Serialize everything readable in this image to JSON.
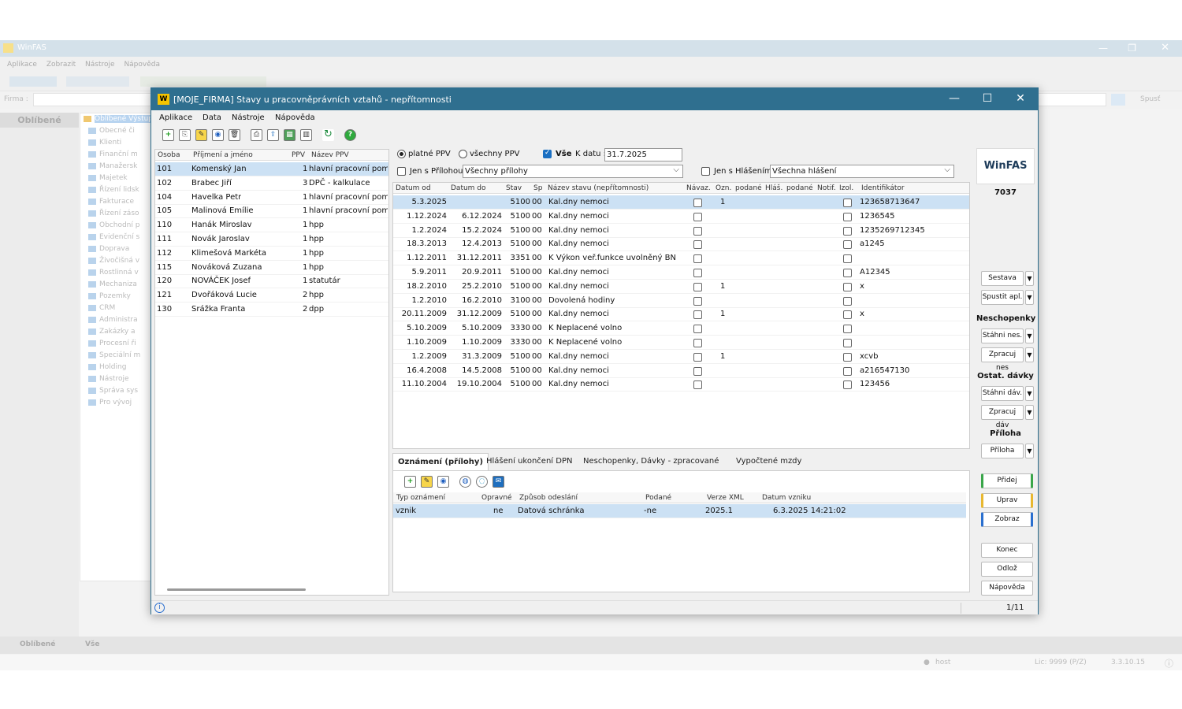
{
  "bg": {
    "title": "WinFAS",
    "menu": [
      "Aplikace",
      "Zobrazit",
      "Nástroje",
      "Nápověda"
    ],
    "firma_label": "Firma :",
    "spust": "Spusť",
    "left_header": "Oblíbené",
    "tree_selected": "Oblíbené Výstupy",
    "tree_items": [
      "Obecné či",
      "Klienti",
      "Finanční m",
      "Manažersk",
      "Majetek",
      "Řízení lidsk",
      "Fakturace",
      "Řízení záso",
      "Obchodní p",
      "Evidenční s",
      "Doprava",
      "Živočišná v",
      "Rostlinná v",
      "Mechaniza",
      "Pozemky",
      "CRM",
      "Administra",
      "Zakázky a",
      "Procesní ři",
      "Speciální m",
      "Holding",
      "Nástroje",
      "Správa sys",
      "Pro vývoj"
    ],
    "bottom_tabs": [
      "Oblíbené",
      "Vše"
    ],
    "status_user": "host",
    "status_lic": "Lic: 9999 (P/Z)",
    "status_ver": "3.3.10.15"
  },
  "win": {
    "title": "[MOJE_FIRMA] Stavy u pracovněprávních vztahů - nepřítomnosti",
    "menu": [
      "Aplikace",
      "Data",
      "Nástroje",
      "Nápověda"
    ],
    "left_grid": {
      "headers": [
        "Osoba",
        "Příjmení a jméno",
        "PPV",
        "Název PPV"
      ],
      "rows": [
        {
          "id": "101",
          "name": "Komenský Jan",
          "ppv": "1",
          "nazev": "hlavní pracovní pom"
        },
        {
          "id": "102",
          "name": "Brabec Jiří",
          "ppv": "3",
          "nazev": "DPČ - kalkulace"
        },
        {
          "id": "104",
          "name": "Havelka Petr",
          "ppv": "1",
          "nazev": "hlavní pracovní pom"
        },
        {
          "id": "105",
          "name": "Malinová Emílie",
          "ppv": "1",
          "nazev": "hlavní pracovní pom"
        },
        {
          "id": "110",
          "name": "Hanák Miroslav",
          "ppv": "1",
          "nazev": "hpp"
        },
        {
          "id": "111",
          "name": "Novák Jaroslav",
          "ppv": "1",
          "nazev": "hpp"
        },
        {
          "id": "112",
          "name": "Klimešová Markéta",
          "ppv": "1",
          "nazev": "hpp"
        },
        {
          "id": "115",
          "name": "Nováková Zuzana",
          "ppv": "1",
          "nazev": "hpp"
        },
        {
          "id": "120",
          "name": "NOVÁČEK Josef",
          "ppv": "1",
          "nazev": "statutár"
        },
        {
          "id": "121",
          "name": "Dvořáková Lucie",
          "ppv": "2",
          "nazev": "hpp"
        },
        {
          "id": "130",
          "name": "Srážka Franta",
          "ppv": "2",
          "nazev": "dpp"
        }
      ]
    },
    "filters": {
      "radio_platne": "platné PPV",
      "radio_vsechny": "všechny PPV",
      "vse_label": "Vše",
      "k_datu_label": "K datu :",
      "k_datu_value": "31.7.2025",
      "jen_prilohou": "Jen s Přílohou",
      "prilohy_value": "Všechny přílohy",
      "jen_hlasenim": "Jen s Hlášením",
      "hlaseni_value": "Všechna hlášení"
    },
    "right_grid": {
      "headers": [
        "Datum od",
        "Datum do",
        "Stav",
        "Sp",
        "Název stavu (nepřítomnosti)",
        "Návaz.",
        "Ozn.",
        "podané",
        "Hláš.",
        "podané",
        "Notif.",
        "Izol.",
        "Identifikátor"
      ],
      "rows": [
        {
          "od": "5.3.2025",
          "do": "",
          "stav": "5100",
          "sp": "00",
          "nazev": "Kal.dny nemoci",
          "ozn": "1",
          "id": "123658713647"
        },
        {
          "od": "1.12.2024",
          "do": "6.12.2024",
          "stav": "5100",
          "sp": "00",
          "nazev": "Kal.dny nemoci",
          "ozn": "",
          "id": "1236545"
        },
        {
          "od": "1.2.2024",
          "do": "15.2.2024",
          "stav": "5100",
          "sp": "00",
          "nazev": "Kal.dny nemoci",
          "ozn": "",
          "id": "1235269712345"
        },
        {
          "od": "18.3.2013",
          "do": "12.4.2013",
          "stav": "5100",
          "sp": "00",
          "nazev": "Kal.dny nemoci",
          "ozn": "",
          "id": "a1245"
        },
        {
          "od": "1.12.2011",
          "do": "31.12.2011",
          "stav": "3351",
          "sp": "00",
          "nazev": "K Výkon veř.funkce uvolněný BN",
          "ozn": "",
          "id": ""
        },
        {
          "od": "5.9.2011",
          "do": "20.9.2011",
          "stav": "5100",
          "sp": "00",
          "nazev": "Kal.dny nemoci",
          "ozn": "",
          "id": "A12345"
        },
        {
          "od": "18.2.2010",
          "do": "25.2.2010",
          "stav": "5100",
          "sp": "00",
          "nazev": "Kal.dny nemoci",
          "ozn": "1",
          "id": "x"
        },
        {
          "od": "1.2.2010",
          "do": "16.2.2010",
          "stav": "3100",
          "sp": "00",
          "nazev": "Dovolená hodiny",
          "ozn": "",
          "id": ""
        },
        {
          "od": "20.11.2009",
          "do": "31.12.2009",
          "stav": "5100",
          "sp": "00",
          "nazev": "Kal.dny nemoci",
          "ozn": "1",
          "id": "x"
        },
        {
          "od": "5.10.2009",
          "do": "5.10.2009",
          "stav": "3330",
          "sp": "00",
          "nazev": "K Neplacené volno",
          "ozn": "",
          "id": ""
        },
        {
          "od": "1.10.2009",
          "do": "1.10.2009",
          "stav": "3330",
          "sp": "00",
          "nazev": "K Neplacené volno",
          "ozn": "",
          "id": ""
        },
        {
          "od": "1.2.2009",
          "do": "31.3.2009",
          "stav": "5100",
          "sp": "00",
          "nazev": "Kal.dny nemoci",
          "ozn": "1",
          "id": "xcvb"
        },
        {
          "od": "16.4.2008",
          "do": "14.5.2008",
          "stav": "5100",
          "sp": "00",
          "nazev": "Kal.dny nemoci",
          "ozn": "",
          "id": "a216547130"
        },
        {
          "od": "11.10.2004",
          "do": "19.10.2004",
          "stav": "5100",
          "sp": "00",
          "nazev": "Kal.dny nemoci",
          "ozn": "",
          "id": "123456"
        }
      ]
    },
    "tabs": [
      "Oznámení (přílohy)",
      "Hlášení ukončení DPN",
      "Neschopenky, Dávky - zpracované",
      "Vypočtené mzdy"
    ],
    "sub_grid": {
      "headers": [
        "Typ oznámení",
        "Opravné",
        "Způsob odeslání",
        "Podané",
        "Verze XML",
        "Datum vzniku"
      ],
      "rows": [
        {
          "typ": "vznik",
          "opravne": "ne",
          "zpusob": "Datová schránka",
          "podane": "-ne",
          "verze": "2025.1",
          "datum": "6.3.2025 14:21:02"
        }
      ]
    },
    "panel": {
      "logo": "WinFAS",
      "number": "7037",
      "sestava": "Sestava",
      "spustit": "Spustit apl.",
      "neschopenky": "Neschopenky",
      "stahni_nes": "Stáhni nes.",
      "zpracuj_nes": "Zpracuj nes",
      "ostat_davky": "Ostat. dávky",
      "stahni_dav": "Stáhni dáv.",
      "zpracuj_dav": "Zpracuj dáv",
      "priloha_title": "Příloha",
      "priloha": "Příloha",
      "pridej": "Přidej",
      "uprav": "Uprav",
      "zobraz": "Zobraz",
      "konec": "Konec",
      "odloz": "Odlož",
      "napoveda": "Nápověda"
    },
    "status_page": "1/11"
  }
}
